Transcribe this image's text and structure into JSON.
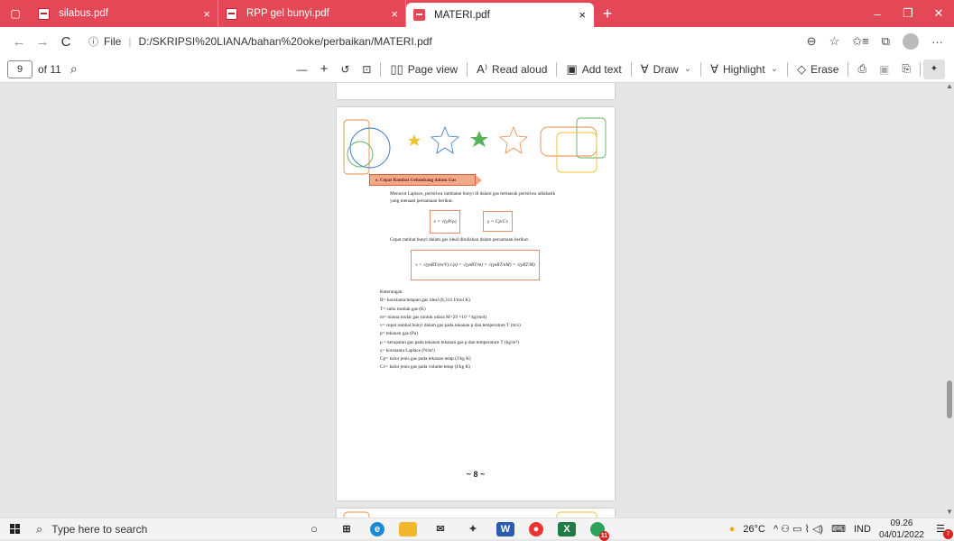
{
  "tabs": [
    {
      "title": "silabus.pdf",
      "close": "×"
    },
    {
      "title": "RPP gel bunyi.pdf",
      "close": "×"
    },
    {
      "title": "MATERI.pdf",
      "close": "×"
    }
  ],
  "new_tab": "+",
  "window": {
    "minimize": "–",
    "restore": "❐",
    "close": "✕"
  },
  "address": {
    "back": "←",
    "forward": "→",
    "refresh": "C",
    "info": "ⓘ",
    "scheme": "File",
    "url": "D:/SKRIPSI%20LIANA/bahan%20oke/perbaikan/MATERI.pdf",
    "right_icons": [
      "⊖",
      "☆",
      "✩≡",
      "⧉",
      "···"
    ]
  },
  "pdf_toolbar": {
    "page": "9",
    "of": "of 11",
    "search_icon": "⌕",
    "zoom_out": "—",
    "zoom_in": "+",
    "rotate": "↺",
    "fit": "⊡",
    "page_view": "Page view",
    "read_aloud": "Read aloud",
    "add_text": "Add text",
    "draw": "Draw",
    "highlight": "Highlight",
    "erase": "Erase",
    "print_icon": "⎙",
    "save_icon": "▣",
    "saveas_icon": "⎘",
    "pin_icon": "📌"
  },
  "page": {
    "section_title": "e.  Cepat Rambat Gelombang dalam Gas",
    "intro": [
      "Menurut Laplace, peristiwa rambatan bunyi di dalam gas termasuk peristiwa adiabatik",
      "yang menaati persamaan berikut."
    ],
    "formula1": "v = √(γP/ρ)",
    "formula2": "γ = Cp/Cv",
    "caption": "Cepat rambat bunyi dalam gas ideal dituliskan dalam persamaan berikut.",
    "formula3": "v = √(γnRT/(m/V)·1/ρ) = √(γnRT/m) = √(γnRT/nM) = √(γRT/M)",
    "keterangan_title": "Keterangan:",
    "keterangan": [
      "R= konstanta/tetapan gas ideal (8,314 J/mol K)",
      "T= suhu mutlak gas (K)",
      "m= massa molar gas (untuk udara M=29 ×10⁻³ kg/mol)",
      "v= cepat rambat bunyi dalam gas pada tekanan p dan temperature T (m/s)",
      "p= tekanan gas (Pa)",
      "ρ = kerapatan gas pada tekanan tekanan gas p dan temperature T (kg/m³)",
      "γ= konstanta Laplace (N/m²)",
      "Cp= kalor jenis gas pada tekanan tetap (J/kg K)",
      "Cv= kalor jenis gas pada volume tetap (J/kg K)"
    ],
    "page_number": "~ 8 ~"
  },
  "taskbar": {
    "search_placeholder": "Type here to search",
    "weather": "26°C",
    "tray_icons": "^ ⚇ ▭ ⌇ ◁)",
    "keyboard": "⌨",
    "lang": "IND",
    "time": "09.26",
    "date": "04/01/2022",
    "notif_count": "7",
    "app_badge": "11"
  },
  "colors": {
    "tabbar": "#e44755",
    "accent_orange": "#e59065",
    "star_yellow": "#f2c12e",
    "star_blue": "#3a78c9",
    "star_green": "#58b25a",
    "star_orange": "#ee8a46"
  }
}
